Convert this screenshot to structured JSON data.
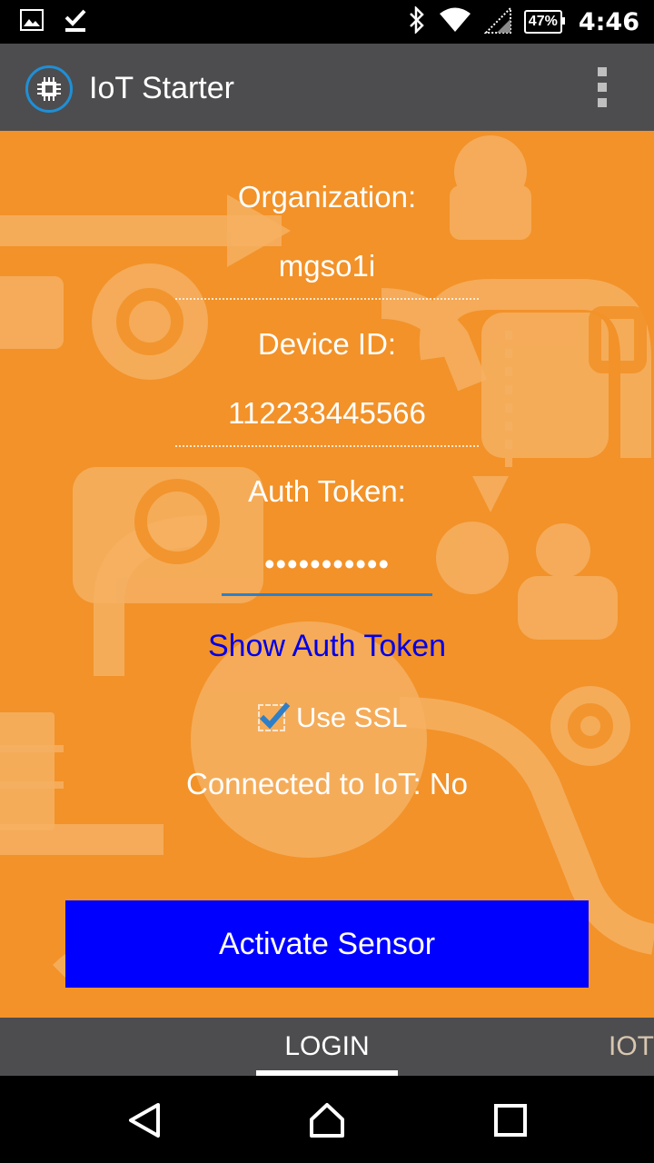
{
  "status_bar": {
    "time": "4:46",
    "battery": "47%",
    "icons": [
      "image-icon",
      "download-done-icon",
      "bluetooth-icon",
      "wifi-icon",
      "cell-signal-icon",
      "battery-icon"
    ]
  },
  "app_bar": {
    "title": "IoT Starter",
    "logo_icon": "chip-icon",
    "menu_icon": "overflow-menu-icon"
  },
  "login": {
    "organization_label": "Organization:",
    "organization_value": "mgso1i",
    "device_id_label": "Device ID:",
    "device_id_value": "112233445566",
    "auth_token_label": "Auth Token:",
    "auth_token_value": "•••••••••••",
    "show_token_link": "Show Auth Token",
    "use_ssl_label": "Use SSL",
    "use_ssl_checked": true,
    "connection_status": "Connected to IoT: No",
    "activate_button": "Activate Sensor"
  },
  "tabs": [
    {
      "label": "LOGIN",
      "selected": true
    },
    {
      "label": "IOT",
      "selected": false
    }
  ],
  "colors": {
    "background": "#f29229",
    "app_bar": "#4d4d4f",
    "primary_button": "#0000ff",
    "link": "#0000e6"
  },
  "nav_bar": {
    "icons": [
      "back-icon",
      "home-icon",
      "recents-icon"
    ]
  }
}
